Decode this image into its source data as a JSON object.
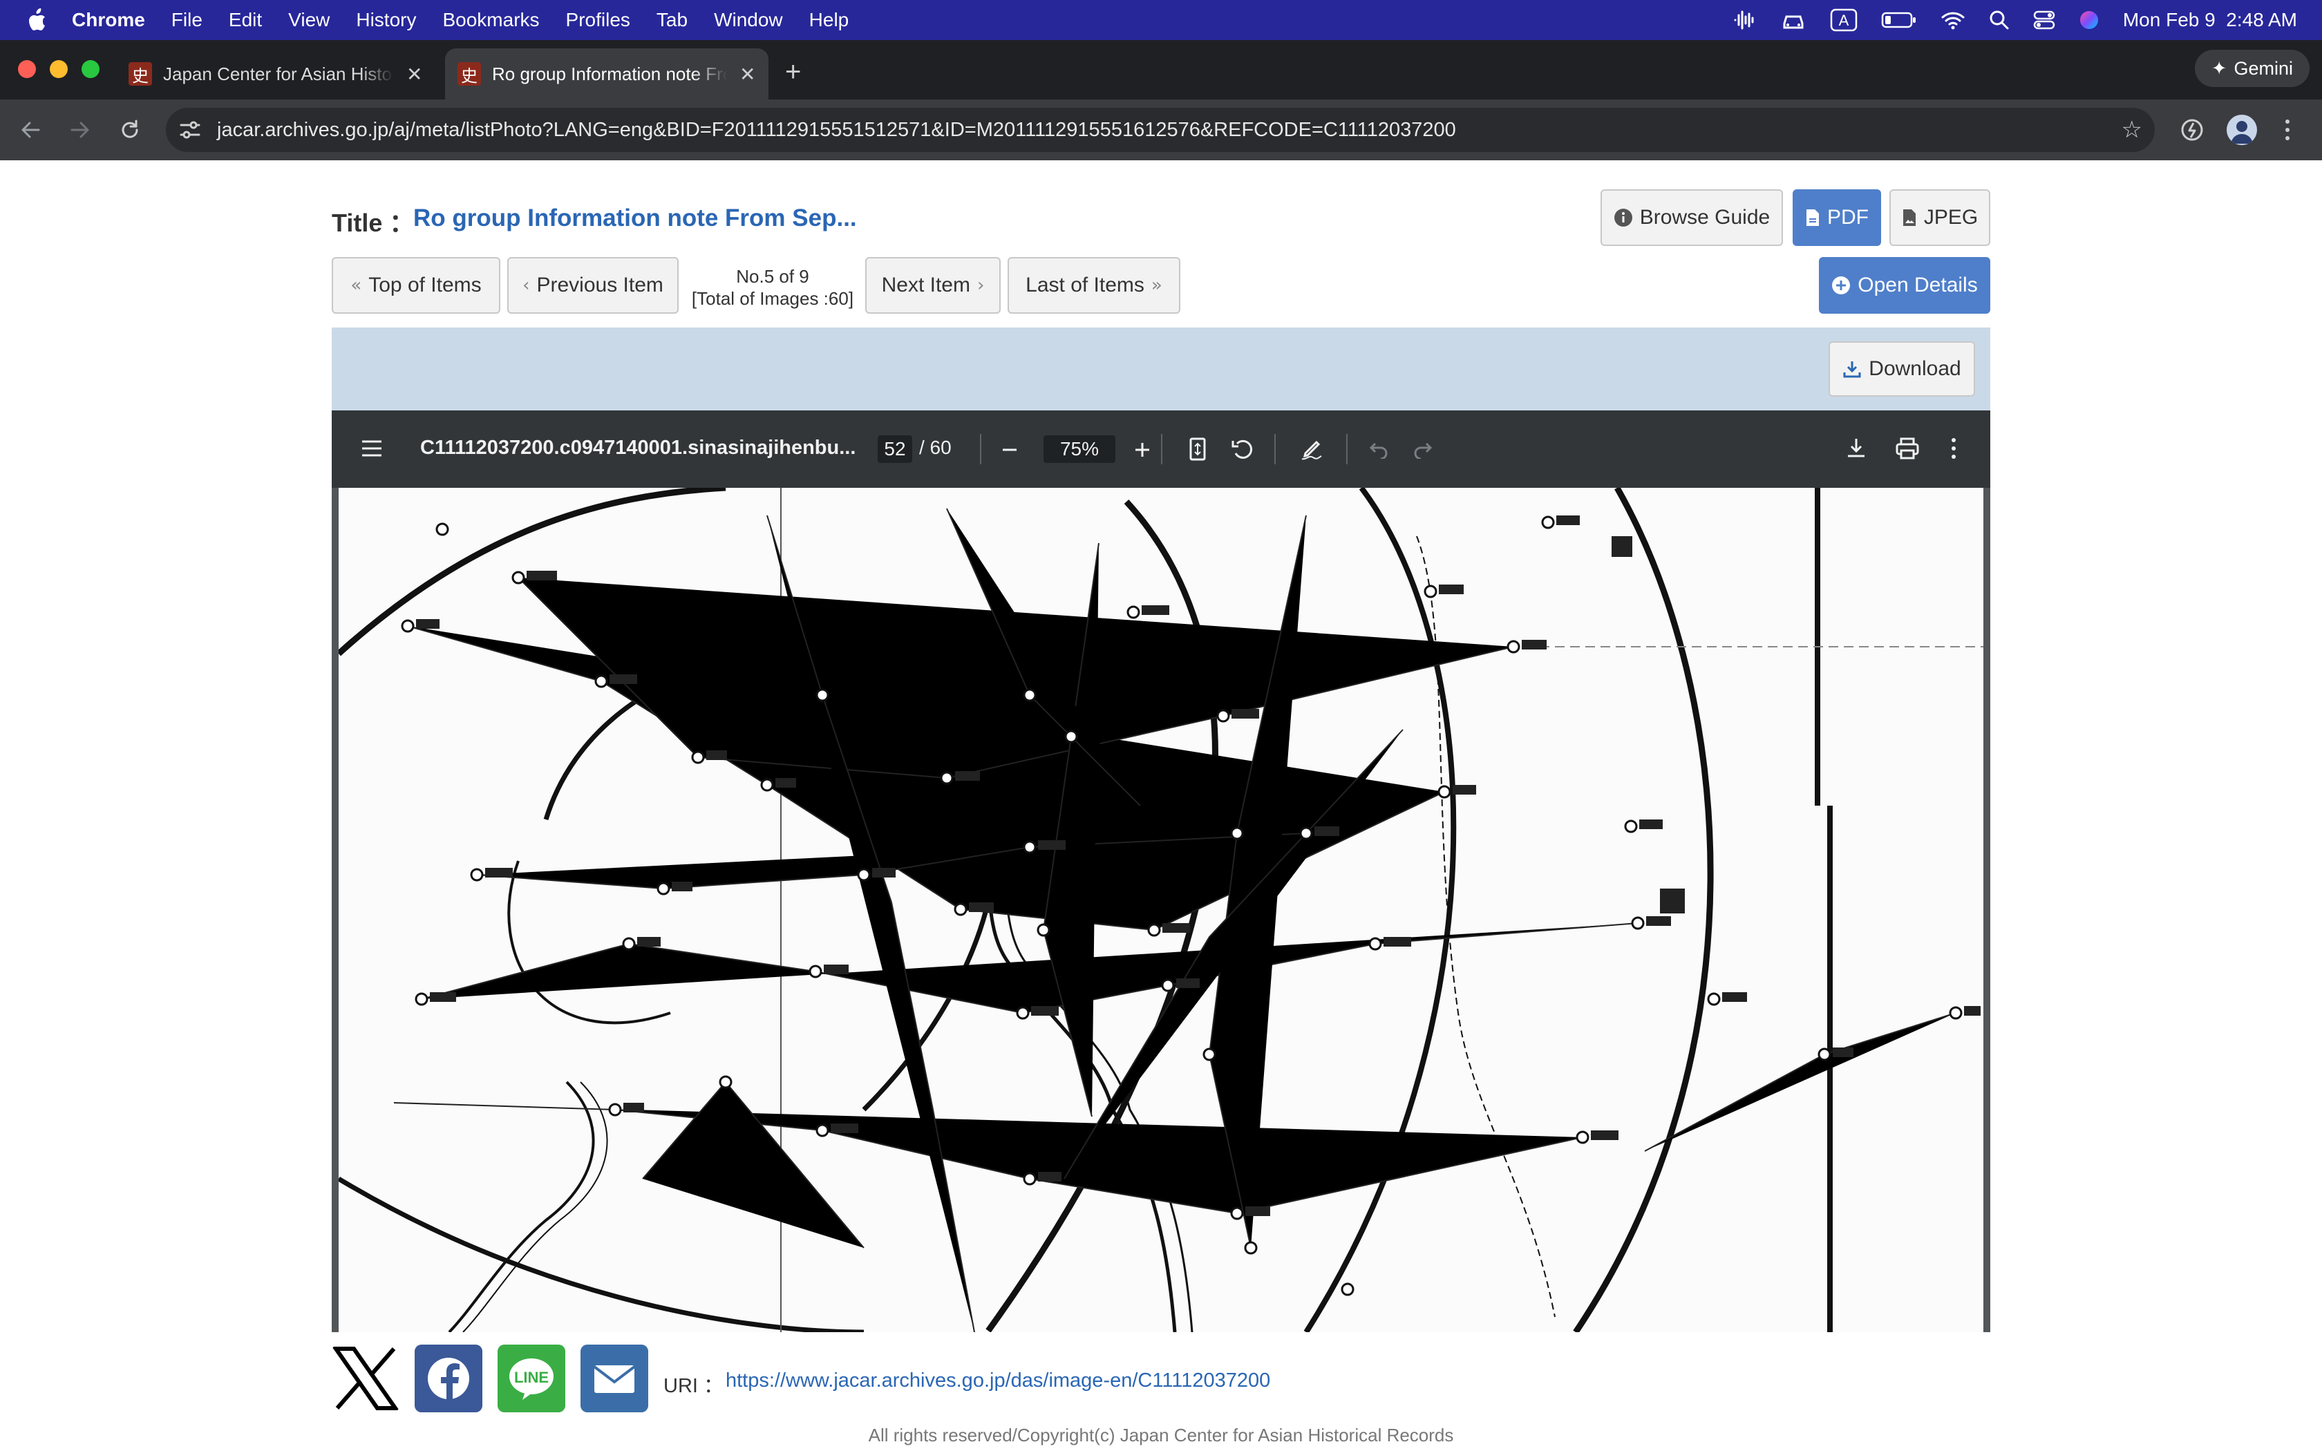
{
  "menubar": {
    "app": "Chrome",
    "items": [
      "File",
      "Edit",
      "View",
      "History",
      "Bookmarks",
      "Profiles",
      "Tab",
      "Window",
      "Help"
    ],
    "datetime": "Mon Feb 9  2:48 AM",
    "input_indicator": "A",
    "status_icons": [
      "audio-wave-icon",
      "car-icon",
      "input-source-icon",
      "battery-icon",
      "wifi-icon",
      "search-icon",
      "control-center-icon",
      "siri-icon"
    ]
  },
  "tabs": [
    {
      "title": "Japan Center for Asian Historical Records",
      "favicon": "史",
      "active": false
    },
    {
      "title": "Ro group Information note From Sep",
      "favicon": "史",
      "active": true
    }
  ],
  "browser": {
    "url": "jacar.archives.go.jp/aj/meta/listPhoto?LANG=eng&BID=F2011112915551512571&ID=M2011112915551612576&REFCODE=C11112037200",
    "gemini_label": "Gemini"
  },
  "page": {
    "title_label": "Title ：",
    "title_value": "Ro group Information note From Sep...",
    "buttons": {
      "browse_guide": "Browse Guide",
      "pdf": "PDF",
      "jpeg": "JPEG",
      "open_details": "Open Details",
      "download": "Download"
    },
    "nav": {
      "top": "Top of Items",
      "previous": "Previous Item",
      "next": "Next Item",
      "last": "Last of Items",
      "counter_line1": "No.5 of 9",
      "counter_line2": "[Total of Images :60]"
    }
  },
  "viewer": {
    "filename": "C11112037200.c0947140001.sinasinajihenbu...",
    "current_page": "52",
    "page_separator": "/ 60",
    "zoom": "75%"
  },
  "footer": {
    "uri_label": "URI ：",
    "uri": "https://www.jacar.archives.go.jp/das/image-en/C11112037200",
    "copyright": "All rights reserved/Copyright(c) Japan Center for Asian Historical Records"
  },
  "colors": {
    "menubar": "#27279a",
    "link": "#2a66b4",
    "primary_button": "#4f7fca",
    "download_bar": "#cad9e8",
    "viewer_toolbar": "#323639"
  }
}
